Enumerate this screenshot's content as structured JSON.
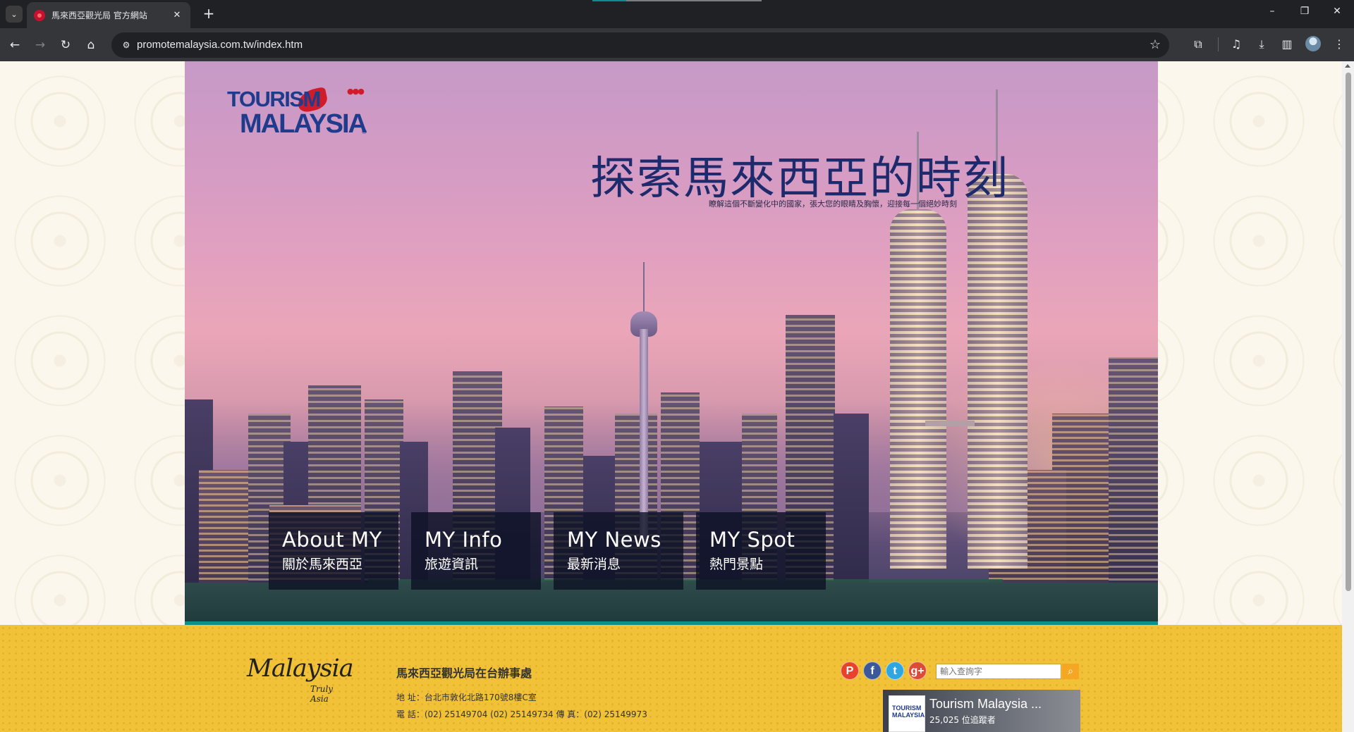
{
  "browser": {
    "tab_title": "馬來西亞觀光局 官方網站",
    "url": "promotemalaysia.com.tw/index.htm"
  },
  "hero": {
    "logo_line1": "TOURISM",
    "logo_line2": "MALAYSIA",
    "logo_reg": "®",
    "title": "探索馬來西亞的時刻",
    "subtitle": "瞭解這個不斷變化中的國家，張大您的眼睛及胸懷，迎接每一個絕妙時刻"
  },
  "nav_tiles": [
    {
      "en": "About MY",
      "zh": "關於馬來西亞"
    },
    {
      "en": "MY Info",
      "zh": "旅遊資訊"
    },
    {
      "en": "MY News",
      "zh": "最新消息"
    },
    {
      "en": "MY Spot",
      "zh": "熱門景點"
    }
  ],
  "footer": {
    "logo_script": "Malaysia",
    "logo_sub": "Truly Asia",
    "office_name": "馬來西亞觀光局在台辦事處",
    "address": "地 址：台北市敦化北路170號8樓C室",
    "phone": "電 話：(02) 25149704 (02) 25149734 傳 真：(02) 25149973",
    "search_placeholder": "輸入查詢字",
    "facebook": {
      "thumb_text": "TOURISM MALAYSIA",
      "name": "Tourism Malaysia ...",
      "followers": "25,025 位追蹤者"
    },
    "social": [
      {
        "glyph": "P",
        "color": "#e8412c"
      },
      {
        "glyph": "f",
        "color": "#3b5998"
      },
      {
        "glyph": "t",
        "color": "#2fa6e0"
      },
      {
        "glyph": "g+",
        "color": "#dc4a38"
      }
    ]
  }
}
